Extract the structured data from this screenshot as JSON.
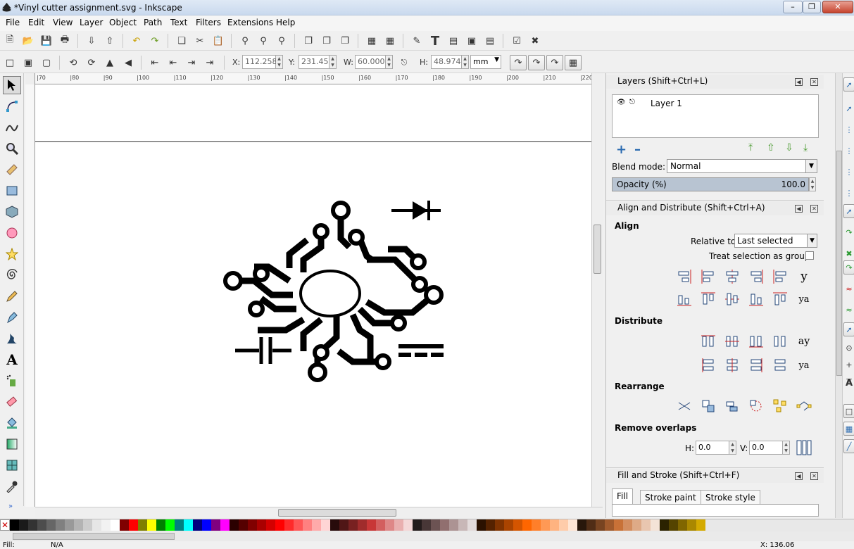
{
  "window": {
    "title": "*Vinyl cutter assignment.svg - Inkscape"
  },
  "menu": [
    "File",
    "Edit",
    "View",
    "Layer",
    "Object",
    "Path",
    "Text",
    "Filters",
    "Extensions",
    "Help"
  ],
  "toolctrl": {
    "x_label": "X:",
    "x": "112.258",
    "y_label": "Y:",
    "y": "231.451",
    "w_label": "W:",
    "w": "60.000",
    "h_label": "H:",
    "h": "48.974",
    "unit": "mm"
  },
  "ruler": {
    "h_ticks": [
      "|70",
      "|80",
      "|90",
      "|100",
      "|110",
      "|120",
      "|130",
      "|140",
      "|150",
      "|160",
      "|170",
      "|180",
      "|190",
      "|200",
      "|210",
      "|220"
    ]
  },
  "layers": {
    "title": "Layers (Shift+Ctrl+L)",
    "layer_name": "Layer 1",
    "blend_label": "Blend mode:",
    "blend_value": "Normal",
    "opacity_label": "Opacity (%)",
    "opacity_value": "100.0",
    "opacity_level": 1.0
  },
  "align": {
    "title": "Align and Distribute (Shift+Ctrl+A)",
    "align_heading": "Align",
    "relative_label": "Relative to:",
    "relative_value": "Last selected",
    "treat_group_label": "Treat selection as group:",
    "distribute_heading": "Distribute",
    "rearrange_heading": "Rearrange",
    "remove_overlaps_heading": "Remove overlaps",
    "h_label": "H:",
    "h_value": "0.0",
    "v_label": "V:",
    "v_value": "0.0"
  },
  "fillstroke": {
    "title": "Fill and Stroke (Shift+Ctrl+F)",
    "tabs": [
      "Fill",
      "Stroke paint",
      "Stroke style"
    ]
  },
  "status": {
    "fill_label": "Fill:",
    "fill_value": "N/A",
    "coords": "X: 136.06"
  },
  "palette": [
    "#000000",
    "#1a1a1a",
    "#333333",
    "#4d4d4d",
    "#666666",
    "#808080",
    "#999999",
    "#b3b3b3",
    "#cccccc",
    "#e6e6e6",
    "#f2f2f2",
    "#ffffff",
    "#800000",
    "#ff0000",
    "#808000",
    "#ffff00",
    "#008000",
    "#00ff00",
    "#008080",
    "#00ffff",
    "#000080",
    "#0000ff",
    "#800080",
    "#ff00ff",
    "#2b0000",
    "#550000",
    "#800000",
    "#aa0000",
    "#d40000",
    "#ff0000",
    "#ff2a2a",
    "#ff5555",
    "#ff8080",
    "#ffaaaa",
    "#ffd5d5",
    "#280b0b",
    "#501616",
    "#782121",
    "#a02c2c",
    "#c83737",
    "#d35f5f",
    "#de8787",
    "#e9afaf",
    "#f4d7d7",
    "#241c1c",
    "#483737",
    "#6c5353",
    "#916f6f",
    "#ac9393",
    "#c8b7b7",
    "#e3dbdb",
    "#2b1100",
    "#552200",
    "#803300",
    "#aa4400",
    "#d45500",
    "#ff6600",
    "#ff7f2a",
    "#ff9955",
    "#ffb380",
    "#ffccaa",
    "#ffe6d5",
    "#28170b",
    "#502d16",
    "#784421",
    "#a05a2c",
    "#c87137",
    "#d38d5f",
    "#deaa87",
    "#e9c6af",
    "#f4e3d7",
    "#2b2200",
    "#554400",
    "#806600",
    "#aa8800",
    "#d4aa00"
  ]
}
